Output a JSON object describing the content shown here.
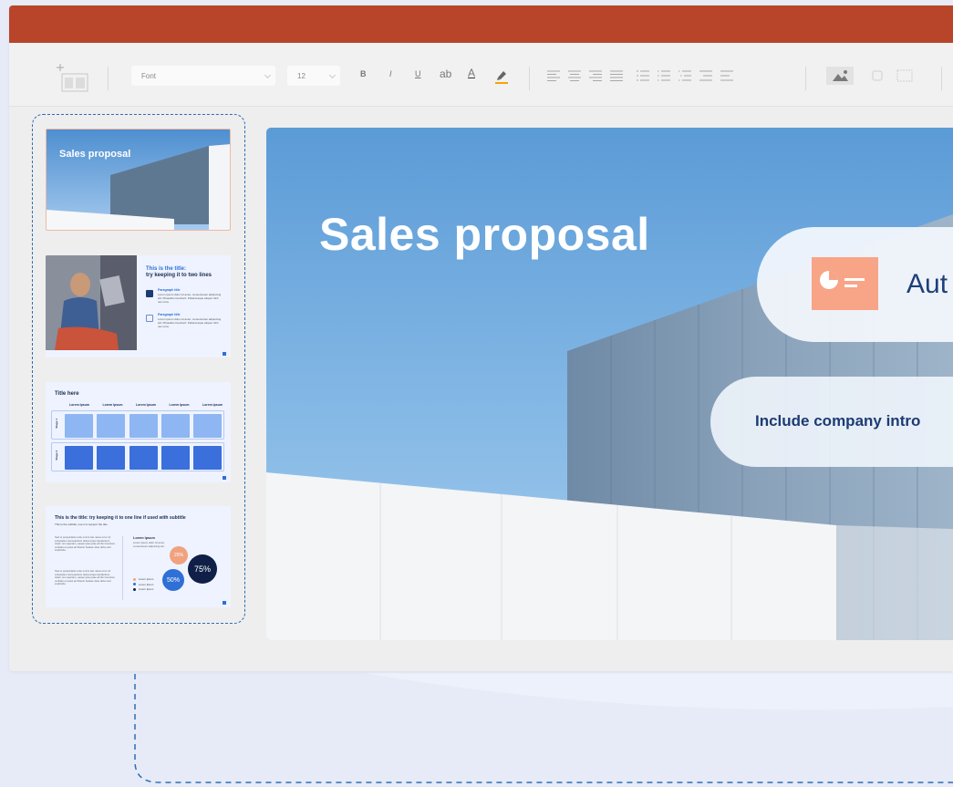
{
  "toolbar": {
    "font_placeholder": "Font",
    "font_size": "12",
    "bold": "B",
    "italic": "I",
    "underline": "U",
    "strikethrough": "ab",
    "font_color": "A"
  },
  "colors": {
    "titlebar": "#b8452a",
    "accent_blue": "#2d6cb5",
    "slide_text": "#1e3f7a",
    "icon_orange": "#f8a486"
  },
  "thumbnails": [
    {
      "title": "Sales proposal"
    },
    {
      "title_line1": "This is the title:",
      "title_line2": "try keeping it to two lines",
      "para1_title": "Paragraph title",
      "para1_body": "Lorem ipsum dolor sit amet, consectetuer adipiscing elit. Phasellus hendrerit. Pellentesque aliquet nibh nec urna.",
      "para2_title": "Paragraph title",
      "para2_body": "Lorem ipsum dolor sit amet, consectetuer adipiscing elit. Phasellus hendrerit. Pellentesque aliquet nibh nec urna."
    },
    {
      "title": "Title here",
      "columns": [
        "Lorem Ipsum",
        "Lorem Ipsum",
        "Lorem Ipsum",
        "Lorem Ipsum",
        "Lorem Ipsum"
      ],
      "rows": [
        "Stage 1",
        "Stage 2"
      ]
    },
    {
      "title": "This is the title: try keeping it to one line if used with subtitle",
      "subtitle": "This is the subtitle, use it to support the title",
      "body": "Sed ut perspiciatis unde omnis iste natus error sit voluptatem accusantium doloremque laudantium, totam rem aperiam, eaque ipsa quae ab illo inventore veritatis et quasi architecto beatae vitae dicta sunt explicabo.",
      "side_title": "Lorem Ipsum",
      "side_body": "Lorem ipsum dolor sit amet, consectetuer adipiscing elit.",
      "stats": [
        {
          "label": "25%",
          "value": 25,
          "color": "#f0a27f"
        },
        {
          "label": "50%",
          "value": 50,
          "color": "#2f6fd6"
        },
        {
          "label": "75%",
          "value": 75,
          "color": "#0f1f47"
        }
      ],
      "legend": [
        "Lorem Ipsum",
        "Lorem Ipsum",
        "Lorem Ipsum"
      ]
    }
  ],
  "slide": {
    "title": "Sales proposal",
    "card1_text": "Aut",
    "card2_text": "Include company intro"
  }
}
